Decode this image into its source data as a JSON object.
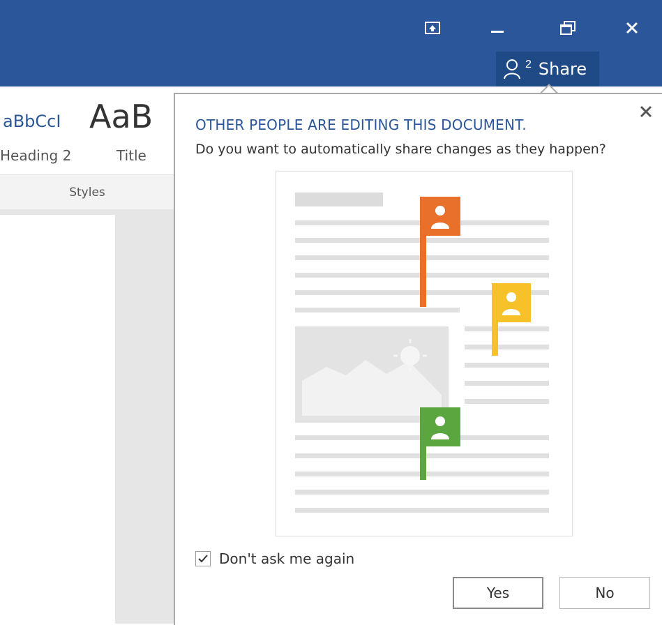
{
  "window_controls": {
    "ribbon_display_icon": "ribbon-display-options-icon",
    "minimize_icon": "minimize-icon",
    "restore_icon": "restore-icon",
    "close_icon": "close-icon"
  },
  "share": {
    "icon": "people-icon",
    "count": "2",
    "label": "Share"
  },
  "ribbon": {
    "styles": [
      {
        "sample": "aBbCcI",
        "name": "Heading 2"
      },
      {
        "sample": "AaB",
        "name": "Title"
      }
    ],
    "group_label": "Styles"
  },
  "callout": {
    "title": "OTHER PEOPLE ARE EDITING THIS DOCUMENT.",
    "subtitle": "Do you want to automatically share changes as they happen?",
    "checkbox": {
      "label": "Don't ask me again",
      "checked": true
    },
    "buttons": {
      "yes": "Yes",
      "no": "No"
    },
    "flag_colors": {
      "orange": "#e8702a",
      "yellow": "#f6c129",
      "green": "#5ba63e"
    }
  },
  "colors": {
    "titlebar": "#2b579a",
    "accent_text": "#2b579a"
  }
}
